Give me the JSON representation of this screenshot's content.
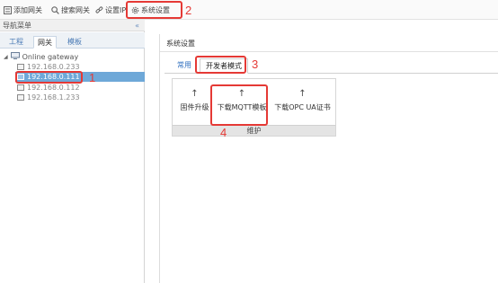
{
  "toolbar": {
    "add_gateway": "添加网关",
    "search_gateway": "搜索网关",
    "set_ip": "设置IP",
    "system_settings": "系统设置"
  },
  "sidebar": {
    "header": "导航菜单",
    "collapse": "«",
    "tabs": [
      "工程",
      "网关",
      "模板"
    ],
    "root": "Online gateway",
    "items": [
      "192.168.0.233",
      "192.168.0.111",
      "192.168.0.112",
      "192.168.1.233"
    ]
  },
  "main": {
    "title": "系统设置",
    "tabs": [
      "常用",
      "开发者模式"
    ],
    "buttons": [
      {
        "icon": "↑",
        "label": "固件升级"
      },
      {
        "icon": "↑",
        "label": "下载MQTT模板"
      },
      {
        "icon": "↑",
        "label": "下载OPC UA证书"
      }
    ],
    "group_label": "维护"
  },
  "callouts": [
    "1",
    "2",
    "3",
    "4"
  ],
  "colors": {
    "annotation": "#e53935",
    "selection": "#6ea8d8",
    "link": "#2f6fbf"
  }
}
